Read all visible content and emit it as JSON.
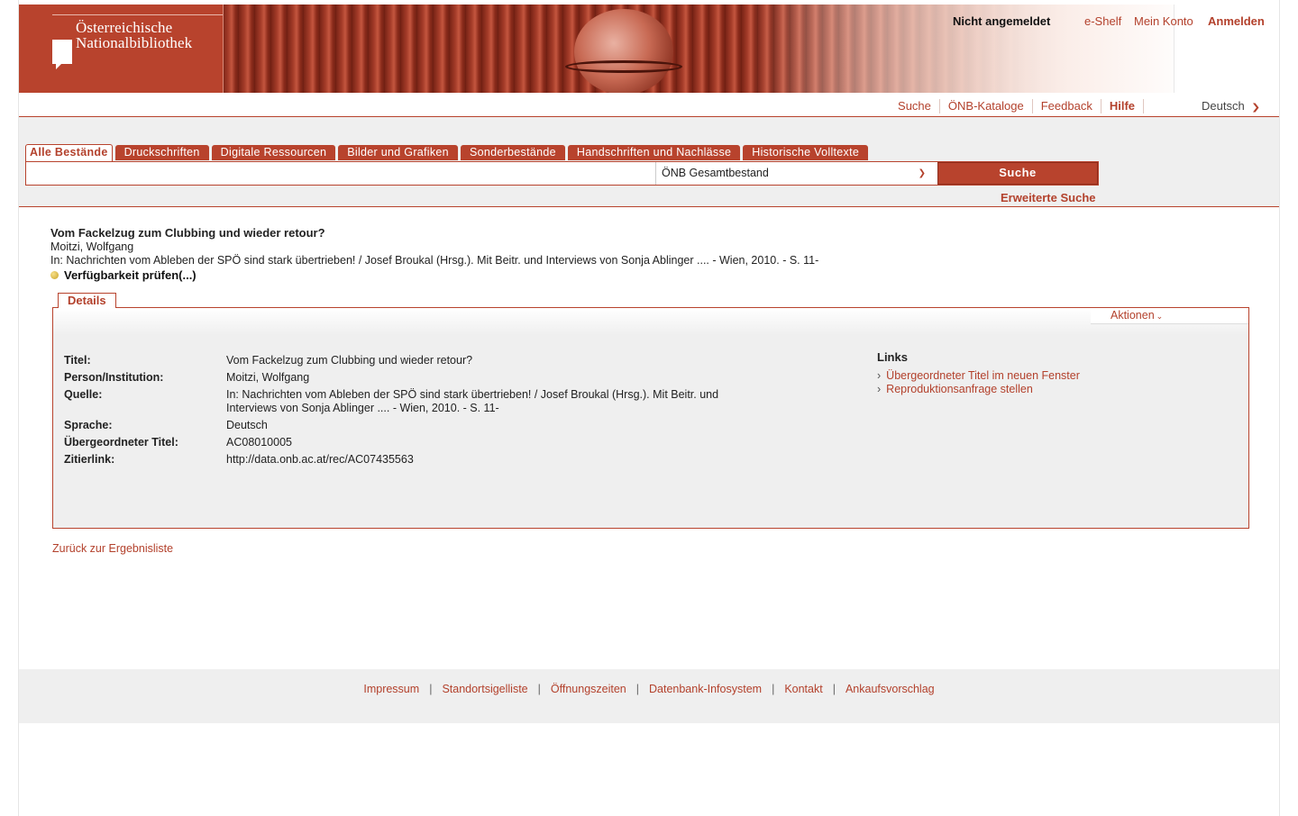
{
  "header": {
    "logo_line1": "Österreichische",
    "logo_line2": "Nationalbibliothek",
    "status": "Nicht angemeldet",
    "links": [
      "e-Shelf",
      "Mein Konto",
      "Anmelden"
    ]
  },
  "subnav": {
    "items": [
      "Suche",
      "ÖNB-Kataloge",
      "Feedback",
      "Hilfe"
    ],
    "language": "Deutsch"
  },
  "search": {
    "tabs": [
      "Alle Bestände",
      "Druckschriften",
      "Digitale Ressourcen",
      "Bilder und Grafiken",
      "Sonderbestände",
      "Handschriften und Nachlässe",
      "Historische Volltexte"
    ],
    "active_tab": "Alle Bestände",
    "query": "",
    "scope": "ÖNB Gesamtbestand",
    "button": "Suche",
    "advanced": "Erweiterte Suche"
  },
  "record": {
    "title": "Vom Fackelzug zum Clubbing und wieder retour?",
    "author": "Moitzi, Wolfgang",
    "source": "In: Nachrichten vom Ableben der SPÖ sind stark übertrieben! / Josef Broukal (Hrsg.). Mit Beitr. und Interviews von Sonja Ablinger .... - Wien, 2010. - S. 11-",
    "availability": "Verfügbarkeit prüfen(...)"
  },
  "details": {
    "tab": "Details",
    "actions": "Aktionen",
    "fields": [
      {
        "label": "Titel:",
        "value": "Vom Fackelzug zum Clubbing und wieder retour?"
      },
      {
        "label": "Person/Institution:",
        "value": "Moitzi, Wolfgang"
      },
      {
        "label": "Quelle:",
        "value": "In: Nachrichten vom Ableben der SPÖ sind stark übertrieben! / Josef Broukal (Hrsg.). Mit Beitr. und Interviews von Sonja Ablinger .... - Wien, 2010. - S. 11-"
      },
      {
        "label": "Sprache:",
        "value": "Deutsch"
      },
      {
        "label": "Übergeordneter Titel:",
        "value": "AC08010005"
      },
      {
        "label": "Zitierlink:",
        "value": "http://data.onb.ac.at/rec/AC07435563"
      }
    ],
    "links_heading": "Links",
    "links": [
      "Übergeordneter Titel im neuen Fenster",
      "Reproduktionsanfrage stellen"
    ]
  },
  "back_link": "Zurück zur Ergebnisliste",
  "footer": {
    "links": [
      "Impressum",
      "Standortsigelliste",
      "Öffnungszeiten",
      "Datenbank-Infosystem",
      "Kontakt",
      "Ankaufsvorschlag"
    ],
    "separator": "|"
  },
  "colors": {
    "brand": "#b8432d",
    "panel_bg": "#efefef"
  }
}
